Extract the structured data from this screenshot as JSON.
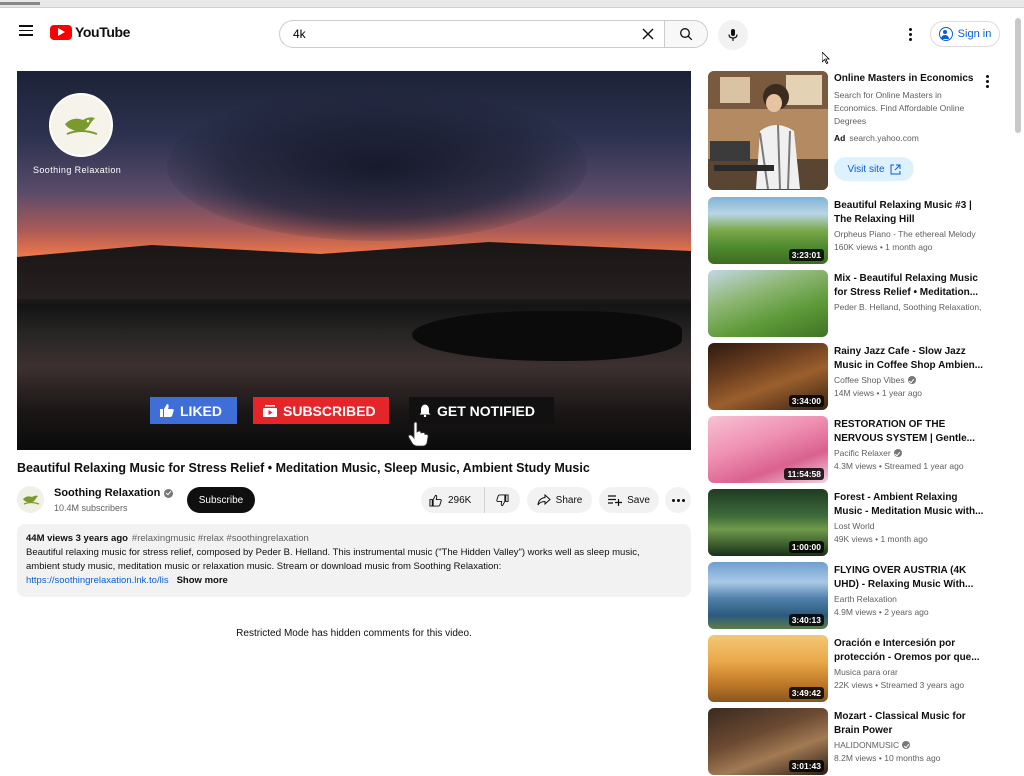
{
  "header": {
    "logo_text": "YouTube",
    "search_value": "4k",
    "sign_in_label": "Sign in"
  },
  "player": {
    "channel_watermark": "Soothing Relaxation",
    "liked_label": "LIKED",
    "subscribed_label": "SUBSCRIBED",
    "notified_label": "GET NOTIFIED"
  },
  "video": {
    "title": "Beautiful Relaxing Music for Stress Relief • Meditation Music, Sleep Music, Ambient Study Music",
    "channel_name": "Soothing Relaxation",
    "subscribers": "10.4M subscribers",
    "subscribe_label": "Subscribe",
    "likes": "296K",
    "share_label": "Share",
    "save_label": "Save"
  },
  "description": {
    "views_date": "44M views  3 years ago",
    "tags": "#relaxingmusic #relax #soothingrelaxation",
    "line1": "Beautiful relaxing music for stress relief, composed by Peder B. Helland. This instrumental music (\"The Hidden Valley\") works well as sleep music,",
    "line2": "ambient study music, meditation music or relaxation music.  Stream or download music from Soothing Relaxation:",
    "link": "https://soothingrelaxation.lnk.to/lis",
    "show_more": "Show more"
  },
  "comments_notice": "Restricted Mode has hidden comments for this video.",
  "ad": {
    "title": "Online Masters in Economics",
    "description": "Search for Online Masters in Economics. Find Affordable Online Degrees",
    "ad_badge": "Ad",
    "domain": "search.yahoo.com",
    "visit_label": "Visit site"
  },
  "sidebar": {
    "items": [
      {
        "title": "Beautiful Relaxing Music #3 | The Relaxing Hill",
        "channel": "Orpheus Piano - The ethereal Melody",
        "verified": false,
        "meta": "160K views  •  1 month ago",
        "duration": "3:23:01",
        "thumb": "linear-gradient(180deg,#7fb2d6 0%,#b9d6e6 25%,#7aa84a 50%,#4f8a2e 75%,#3d6b22 100%)"
      },
      {
        "title": "Mix - Beautiful Relaxing Music for Stress Relief • Meditation...",
        "channel": "Peder B. Helland, Soothing Relaxation, Relaxing Music, and more",
        "verified": false,
        "meta": "",
        "duration": "",
        "thumb": "linear-gradient(160deg,#c3d8e6 0%,#8fb776 35%,#5f9b3a 65%,#3e7324 100%)"
      },
      {
        "title": "Rainy Jazz Cafe - Slow Jazz Music in Coffee Shop Ambien...",
        "channel": "Coffee Shop Vibes",
        "verified": true,
        "meta": "14M views  •  1 year ago",
        "duration": "3:34:00",
        "thumb": "linear-gradient(160deg,#2e1a10 0%,#6b3e1f 35%,#9b5f2d 60%,#3a2214 100%)"
      },
      {
        "title": "RESTORATION OF THE NERVOUS SYSTEM | Gentle...",
        "channel": "Pacific Relaxer",
        "verified": true,
        "meta": "4.3M views  •  Streamed 1 year ago",
        "duration": "11:54:58",
        "thumb": "linear-gradient(160deg,#f7c2d4 0%,#ef8fb1 40%,#d9618e 70%,#f4d3df 100%)"
      },
      {
        "title": "Forest - Ambient Relaxing Music - Meditation Music with...",
        "channel": "Lost World",
        "verified": false,
        "meta": "49K views  •  1 month ago",
        "duration": "1:00:00",
        "thumb": "linear-gradient(180deg,#1f3b22 0%,#3d6b3a 40%,#6f9a4a 60%,#18301a 100%)"
      },
      {
        "title": "FLYING OVER AUSTRIA (4K UHD) - Relaxing Music With...",
        "channel": "Earth Relaxation",
        "verified": false,
        "meta": "4.9M views  •  2 years ago",
        "duration": "3:40:13",
        "thumb": "linear-gradient(180deg,#6f9ed1 0%,#a9c8e6 30%,#4e7fa8 55%,#2d5a7e 80%,#5c7d4a 100%)"
      },
      {
        "title": "Oración e Intercesión por protección - Oremos por que...",
        "channel": "Musica para orar",
        "verified": false,
        "meta": "22K views  •  Streamed 3 years ago",
        "duration": "3:49:42",
        "thumb": "linear-gradient(180deg,#f3c777 0%,#e9a84a 40%,#c47c2a 70%,#8a561f 100%)"
      },
      {
        "title": "Mozart - Classical Music for Brain Power",
        "channel": "HALIDONMUSIC",
        "verified": true,
        "meta": "8.2M views  •  10 months ago",
        "duration": "3:01:43",
        "thumb": "linear-gradient(160deg,#3a2a1f 0%,#6b4a32 40%,#a27a53 65%,#2a1d15 100%)"
      }
    ]
  },
  "colors": {
    "accent_blue": "#065fd4",
    "youtube_red": "#ff0000",
    "liked_blue": "#3f6ed8",
    "subscribed_red": "#e4262b"
  }
}
